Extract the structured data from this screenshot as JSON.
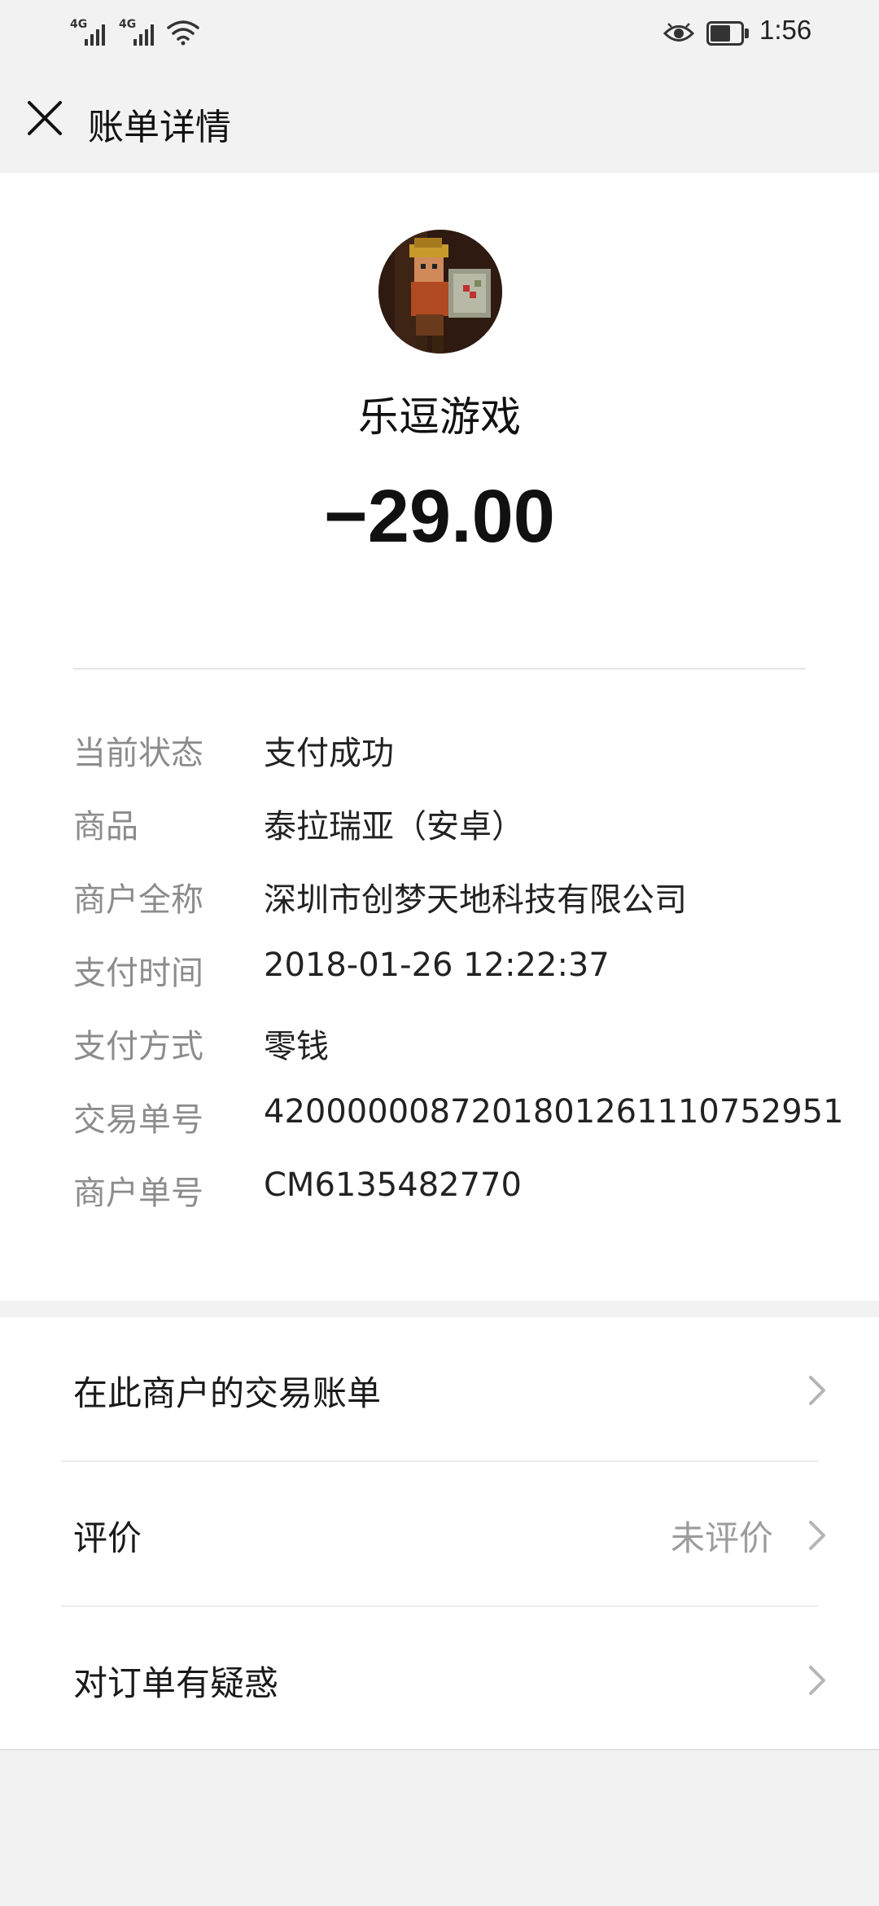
{
  "status_bar": {
    "network_1": "4G",
    "network_2": "4G",
    "time": "1:56",
    "icons": [
      "signal-icon",
      "signal-icon",
      "wifi-icon",
      "eye-icon",
      "battery-icon"
    ]
  },
  "header": {
    "title": "账单详情",
    "close_icon": "close-icon"
  },
  "merchant": {
    "name": "乐逗游戏",
    "amount": "−29.00"
  },
  "details": [
    {
      "label": "当前状态",
      "value": "支付成功"
    },
    {
      "label": "商品",
      "value": "泰拉瑞亚（安卓）"
    },
    {
      "label": "商户全称",
      "value": "深圳市创梦天地科技有限公司"
    },
    {
      "label": "支付时间",
      "value": "2018-01-26 12:22:37"
    },
    {
      "label": "支付方式",
      "value": "零钱"
    },
    {
      "label": "交易单号",
      "value": "4200000087201801261110752951"
    },
    {
      "label": "商户单号",
      "value": "CM6135482770"
    }
  ],
  "menu": [
    {
      "label": "在此商户的交易账单",
      "value": ""
    },
    {
      "label": "评价",
      "value": "未评价"
    },
    {
      "label": "对订单有疑惑",
      "value": ""
    }
  ],
  "colors": {
    "background": "#f2f2f2",
    "card": "#ffffff",
    "label_gray": "#8c8c8c",
    "text": "#1a1a1a"
  }
}
